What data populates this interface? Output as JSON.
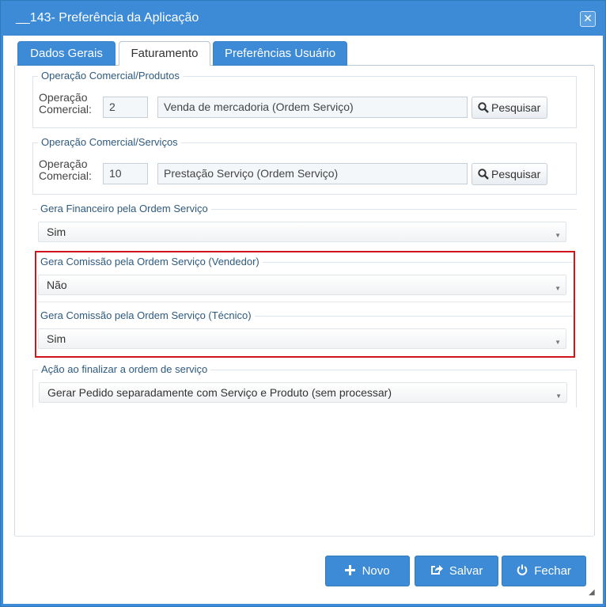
{
  "window": {
    "title": "__143- Preferência da Aplicação"
  },
  "tabs": [
    {
      "label": "Dados Gerais"
    },
    {
      "label": "Faturamento"
    },
    {
      "label": "Preferências Usuário"
    }
  ],
  "produtos": {
    "legend": "Operação Comercial/Produtos",
    "label_line1": "Operação",
    "label_line2": "Comercial:",
    "code": "2",
    "description": "Venda de mercadoria (Ordem Serviço)",
    "search_label": "Pesquisar"
  },
  "servicos": {
    "legend": "Operação Comercial/Serviços",
    "label_line1": "Operação",
    "label_line2": "Comercial:",
    "code": "10",
    "description": "Prestação Serviço (Ordem Serviço)",
    "search_label": "Pesquisar"
  },
  "gera_financeiro": {
    "legend": "Gera Financeiro pela Ordem Serviço",
    "value": "Sim"
  },
  "comissao_vendedor": {
    "legend": "Gera Comissão pela Ordem Serviço (Vendedor)",
    "value": "Não"
  },
  "comissao_tecnico": {
    "legend": "Gera Comissão pela Ordem Serviço (Técnico)",
    "value": "Sim"
  },
  "acao_finalizar": {
    "legend": "Ação ao finalizar a ordem de serviço",
    "value": "Gerar Pedido separadamente com Serviço e Produto (sem processar)"
  },
  "footer": {
    "novo": "Novo",
    "salvar": "Salvar",
    "fechar": "Fechar"
  },
  "colors": {
    "primary": "#3d8bd6",
    "highlight": "#d0161c"
  }
}
